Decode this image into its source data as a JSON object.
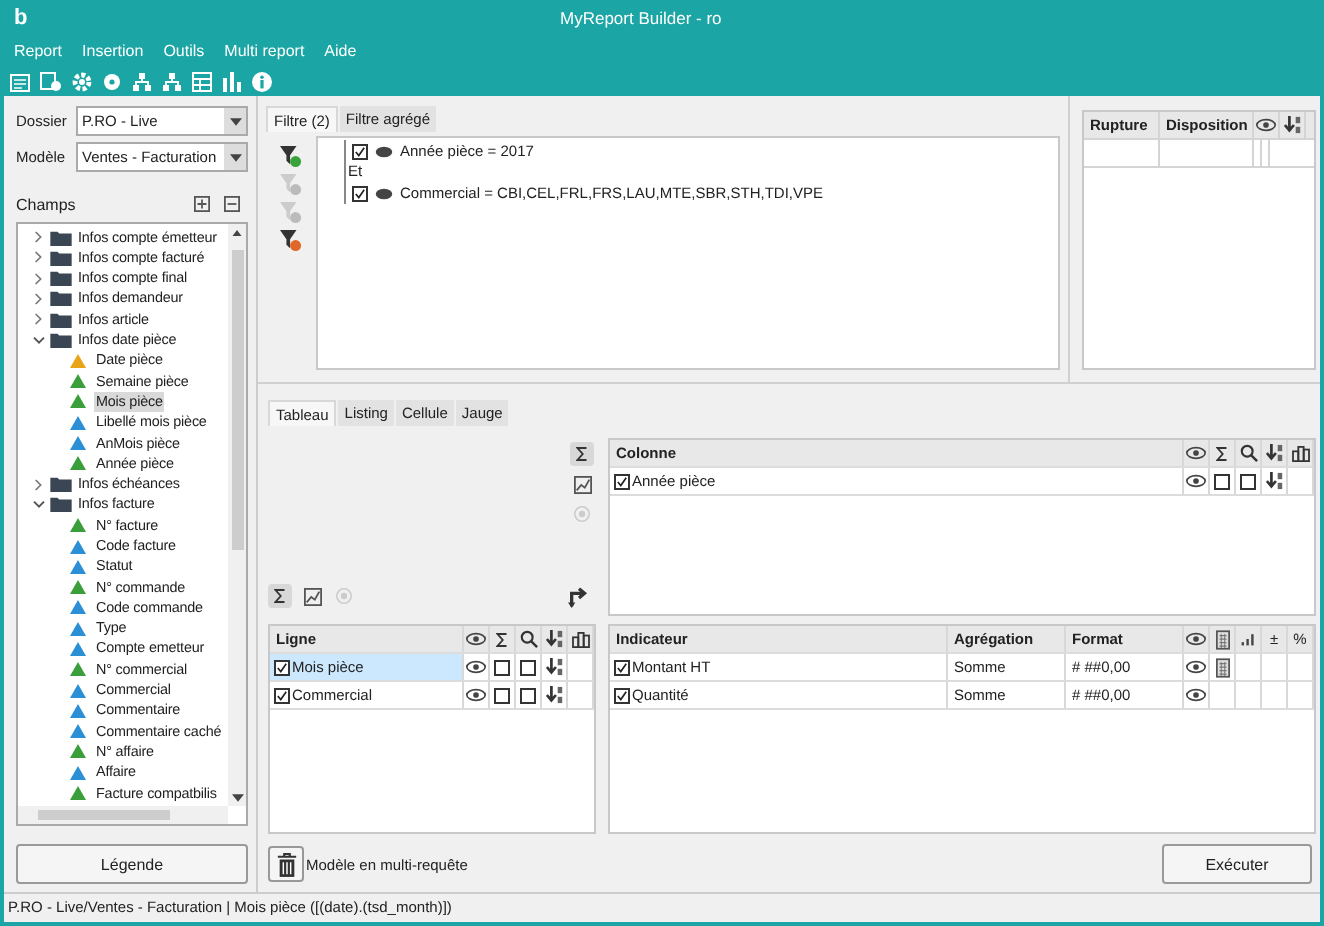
{
  "window": {
    "logo": "b",
    "title": "MyReport Builder - ro"
  },
  "menu": [
    "Report",
    "Insertion",
    "Outils",
    "Multi report",
    "Aide"
  ],
  "left": {
    "dossier": {
      "label": "Dossier",
      "value": "P.RO - Live"
    },
    "modele": {
      "label": "Modèle",
      "value": "Ventes - Facturation"
    },
    "champs": "Champs",
    "tree": [
      {
        "kind": "folder",
        "label": "Infos compte émetteur",
        "expanded": false,
        "selected": false
      },
      {
        "kind": "folder",
        "label": "Infos compte facturé",
        "expanded": false,
        "selected": false
      },
      {
        "kind": "folder",
        "label": "Infos compte final",
        "expanded": false,
        "selected": false
      },
      {
        "kind": "folder",
        "label": "Infos demandeur",
        "expanded": false,
        "selected": false
      },
      {
        "kind": "folder",
        "label": "Infos article",
        "expanded": false,
        "selected": false
      },
      {
        "kind": "folder",
        "label": "Infos date pièce",
        "expanded": true,
        "selected": false,
        "children": [
          {
            "kind": "field",
            "label": "Date pièce",
            "color": "#e8a317",
            "selected": false
          },
          {
            "kind": "field",
            "label": "Semaine pièce",
            "color": "#3a9e3a",
            "selected": false
          },
          {
            "kind": "field",
            "label": "Mois pièce",
            "color": "#3a9e3a",
            "selected": true
          },
          {
            "kind": "field",
            "label": "Libellé mois pièce",
            "color": "#2b8fd6",
            "selected": false
          },
          {
            "kind": "field",
            "label": "AnMois pièce",
            "color": "#2b8fd6",
            "selected": false
          },
          {
            "kind": "field",
            "label": "Année pièce",
            "color": "#3a9e3a",
            "selected": false
          }
        ]
      },
      {
        "kind": "folder",
        "label": "Infos échéances",
        "expanded": false,
        "selected": false
      },
      {
        "kind": "folder",
        "label": "Infos facture",
        "expanded": true,
        "selected": false,
        "children": [
          {
            "kind": "field",
            "label": "N° facture",
            "color": "#3a9e3a",
            "selected": false
          },
          {
            "kind": "field",
            "label": "Code facture",
            "color": "#2b8fd6",
            "selected": false
          },
          {
            "kind": "field",
            "label": "Statut",
            "color": "#2b8fd6",
            "selected": false
          },
          {
            "kind": "field",
            "label": "N° commande",
            "color": "#3a9e3a",
            "selected": false
          },
          {
            "kind": "field",
            "label": "Code commande",
            "color": "#2b8fd6",
            "selected": false
          },
          {
            "kind": "field",
            "label": "Type",
            "color": "#2b8fd6",
            "selected": false
          },
          {
            "kind": "field",
            "label": "Compte emetteur",
            "color": "#2b8fd6",
            "selected": false
          },
          {
            "kind": "field",
            "label": "N° commercial",
            "color": "#3a9e3a",
            "selected": false
          },
          {
            "kind": "field",
            "label": "Commercial",
            "color": "#2b8fd6",
            "selected": false
          },
          {
            "kind": "field",
            "label": "Commentaire",
            "color": "#2b8fd6",
            "selected": false
          },
          {
            "kind": "field",
            "label": "Commentaire caché",
            "color": "#2b8fd6",
            "selected": false
          },
          {
            "kind": "field",
            "label": "N° affaire",
            "color": "#3a9e3a",
            "selected": false
          },
          {
            "kind": "field",
            "label": "Affaire",
            "color": "#2b8fd6",
            "selected": false
          },
          {
            "kind": "field",
            "label": "Facture compatbilis",
            "color": "#3a9e3a",
            "selected": false
          }
        ]
      }
    ],
    "legend_button": "Légende"
  },
  "filter": {
    "tabs": [
      {
        "label": "Filtre (2)",
        "selected": true
      },
      {
        "label": "Filtre agrégé",
        "selected": false
      }
    ],
    "conditions": [
      {
        "checked": true,
        "text": "Année pièce = 2017"
      },
      {
        "checked": true,
        "text": "Commercial = CBI,CEL,FRL,FRS,LAU,MTE,SBR,STH,TDI,VPE"
      }
    ],
    "connector": "Et"
  },
  "rupture": {
    "columns": [
      "Rupture",
      "Disposition"
    ]
  },
  "layout_tabs": [
    {
      "label": "Tableau",
      "selected": true
    },
    {
      "label": "Listing",
      "selected": false
    },
    {
      "label": "Cellule",
      "selected": false
    },
    {
      "label": "Jauge",
      "selected": false
    }
  ],
  "colonne": {
    "header": "Colonne",
    "rows": [
      {
        "checked": true,
        "label": "Année pièce",
        "sigma": false,
        "magnifier": false
      }
    ]
  },
  "ligne": {
    "header": "Ligne",
    "rows": [
      {
        "checked": true,
        "label": "Mois pièce",
        "selected": true,
        "sigma": false,
        "magnifier": false
      },
      {
        "checked": true,
        "label": "Commercial",
        "selected": false,
        "sigma": false,
        "magnifier": false
      }
    ]
  },
  "indicateur": {
    "columns": [
      "Indicateur",
      "Agrégation",
      "Format"
    ],
    "symbol_columns": [
      "±",
      "%"
    ],
    "rows": [
      {
        "checked": true,
        "label": "Montant HT",
        "aggregation": "Somme",
        "format": "# ##0,00",
        "calculator": true
      },
      {
        "checked": true,
        "label": "Quantité",
        "aggregation": "Somme",
        "format": "# ##0,00",
        "calculator": false
      }
    ]
  },
  "multi_request": "Modèle en multi-requête",
  "execute_button": "Exécuter",
  "status_bar": "P.RO - Live/Ventes - Facturation | Mois pièce ([(date).(tsd_month)])"
}
